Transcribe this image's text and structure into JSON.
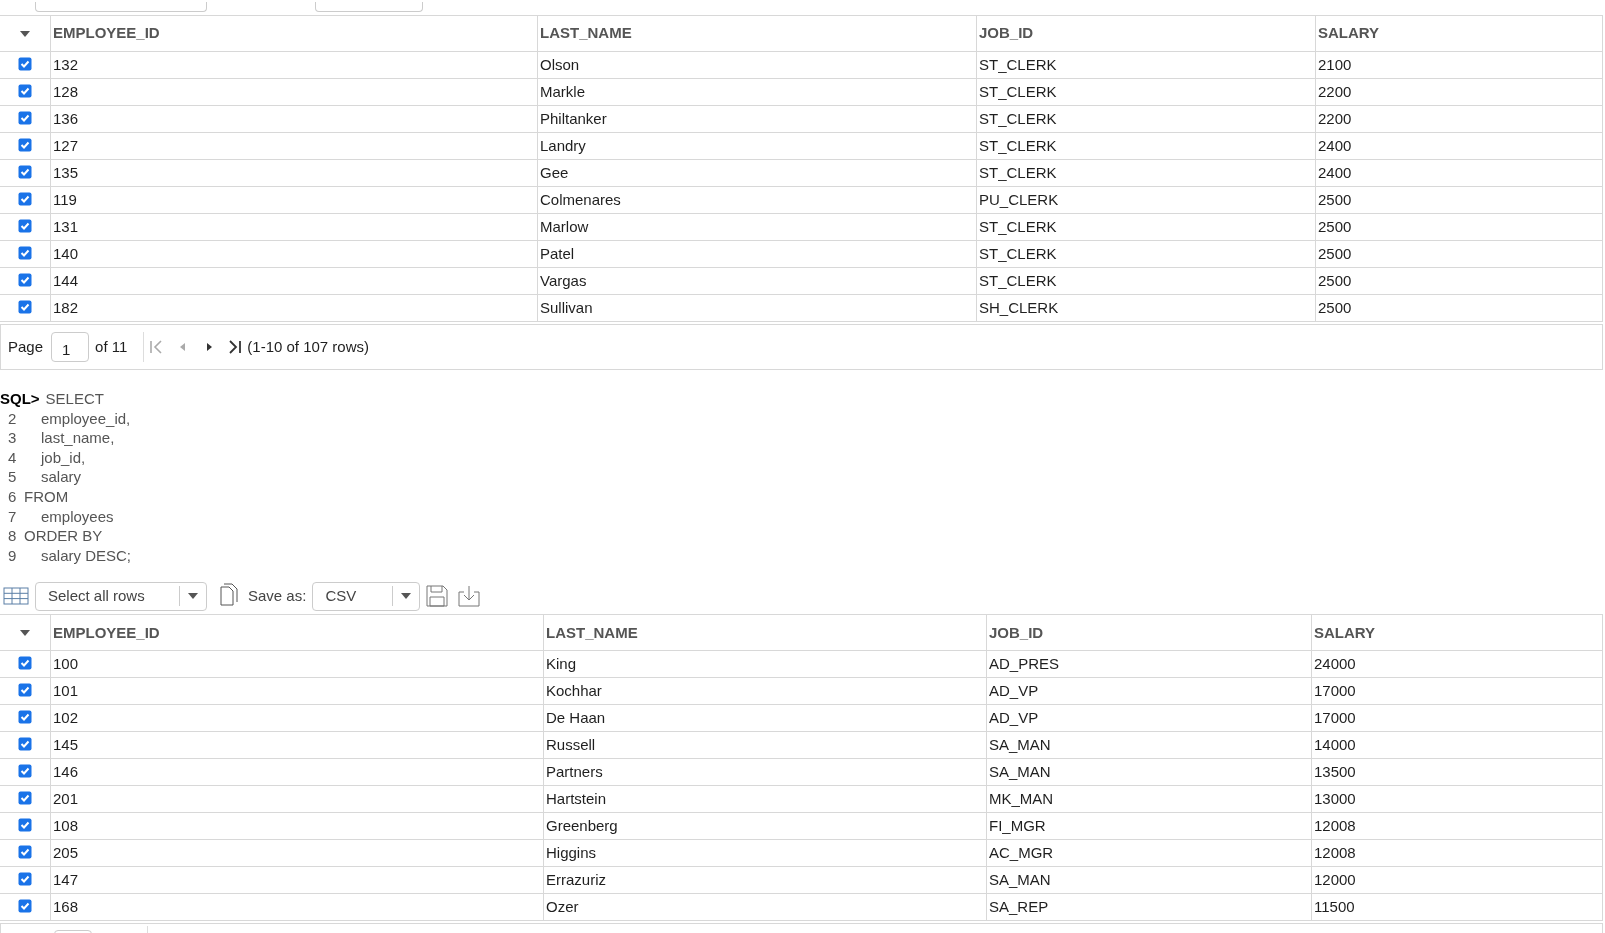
{
  "tables": [
    {
      "columns": [
        "EMPLOYEE_ID",
        "LAST_NAME",
        "JOB_ID",
        "SALARY"
      ],
      "rows": [
        {
          "checked": true,
          "cells": [
            "132",
            "Olson",
            "ST_CLERK",
            "2100"
          ]
        },
        {
          "checked": true,
          "cells": [
            "128",
            "Markle",
            "ST_CLERK",
            "2200"
          ]
        },
        {
          "checked": true,
          "cells": [
            "136",
            "Philtanker",
            "ST_CLERK",
            "2200"
          ]
        },
        {
          "checked": true,
          "cells": [
            "127",
            "Landry",
            "ST_CLERK",
            "2400"
          ]
        },
        {
          "checked": true,
          "cells": [
            "135",
            "Gee",
            "ST_CLERK",
            "2400"
          ]
        },
        {
          "checked": true,
          "cells": [
            "119",
            "Colmenares",
            "PU_CLERK",
            "2500"
          ]
        },
        {
          "checked": true,
          "cells": [
            "131",
            "Marlow",
            "ST_CLERK",
            "2500"
          ]
        },
        {
          "checked": true,
          "cells": [
            "140",
            "Patel",
            "ST_CLERK",
            "2500"
          ]
        },
        {
          "checked": true,
          "cells": [
            "144",
            "Vargas",
            "ST_CLERK",
            "2500"
          ]
        },
        {
          "checked": true,
          "cells": [
            "182",
            "Sullivan",
            "SH_CLERK",
            "2500"
          ]
        }
      ],
      "pagination": {
        "label": "Page",
        "page": "1",
        "of": "of 11",
        "summary": "(1-10 of 107 rows)"
      }
    },
    {
      "toolbar": {
        "select": "Select all rows",
        "save_label": "Save as:",
        "format": "CSV"
      },
      "columns": [
        "EMPLOYEE_ID",
        "LAST_NAME",
        "JOB_ID",
        "SALARY"
      ],
      "rows": [
        {
          "checked": true,
          "cells": [
            "100",
            "King",
            "AD_PRES",
            "24000"
          ]
        },
        {
          "checked": true,
          "cells": [
            "101",
            "Kochhar",
            "AD_VP",
            "17000"
          ]
        },
        {
          "checked": true,
          "cells": [
            "102",
            "De Haan",
            "AD_VP",
            "17000"
          ]
        },
        {
          "checked": true,
          "cells": [
            "145",
            "Russell",
            "SA_MAN",
            "14000"
          ]
        },
        {
          "checked": true,
          "cells": [
            "146",
            "Partners",
            "SA_MAN",
            "13500"
          ]
        },
        {
          "checked": true,
          "cells": [
            "201",
            "Hartstein",
            "MK_MAN",
            "13000"
          ]
        },
        {
          "checked": true,
          "cells": [
            "108",
            "Greenberg",
            "FI_MGR",
            "12008"
          ]
        },
        {
          "checked": true,
          "cells": [
            "205",
            "Higgins",
            "AC_MGR",
            "12008"
          ]
        },
        {
          "checked": true,
          "cells": [
            "147",
            "Errazuriz",
            "SA_MAN",
            "12000"
          ]
        },
        {
          "checked": true,
          "cells": [
            "168",
            "Ozer",
            "SA_REP",
            "11500"
          ]
        }
      ]
    }
  ],
  "sql": {
    "prompt": "SQL>",
    "first": "SELECT",
    "lines": [
      {
        "number": "2",
        "kind": "item",
        "text": "employee_id,"
      },
      {
        "number": "3",
        "kind": "item",
        "text": "last_name,"
      },
      {
        "number": "4",
        "kind": "item",
        "text": "job_id,"
      },
      {
        "number": "5",
        "kind": "item",
        "text": "salary"
      },
      {
        "number": "6",
        "kind": "clause",
        "text": "FROM"
      },
      {
        "number": "7",
        "kind": "item",
        "text": "employees"
      },
      {
        "number": "8",
        "kind": "clause",
        "text": "ORDER BY"
      },
      {
        "number": "9",
        "kind": "item",
        "text": "salary DESC;"
      }
    ]
  }
}
